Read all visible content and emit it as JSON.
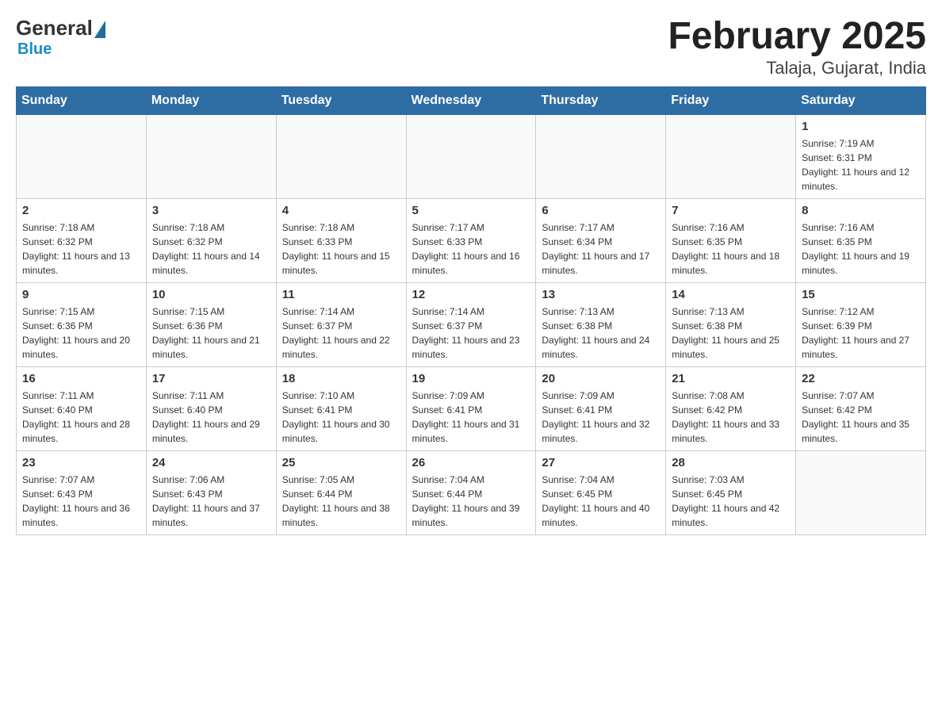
{
  "logo": {
    "general": "General",
    "blue": "Blue"
  },
  "header": {
    "title": "February 2025",
    "subtitle": "Talaja, Gujarat, India"
  },
  "days_of_week": [
    "Sunday",
    "Monday",
    "Tuesday",
    "Wednesday",
    "Thursday",
    "Friday",
    "Saturday"
  ],
  "weeks": [
    [
      {
        "day": "",
        "info": ""
      },
      {
        "day": "",
        "info": ""
      },
      {
        "day": "",
        "info": ""
      },
      {
        "day": "",
        "info": ""
      },
      {
        "day": "",
        "info": ""
      },
      {
        "day": "",
        "info": ""
      },
      {
        "day": "1",
        "info": "Sunrise: 7:19 AM\nSunset: 6:31 PM\nDaylight: 11 hours and 12 minutes."
      }
    ],
    [
      {
        "day": "2",
        "info": "Sunrise: 7:18 AM\nSunset: 6:32 PM\nDaylight: 11 hours and 13 minutes."
      },
      {
        "day": "3",
        "info": "Sunrise: 7:18 AM\nSunset: 6:32 PM\nDaylight: 11 hours and 14 minutes."
      },
      {
        "day": "4",
        "info": "Sunrise: 7:18 AM\nSunset: 6:33 PM\nDaylight: 11 hours and 15 minutes."
      },
      {
        "day": "5",
        "info": "Sunrise: 7:17 AM\nSunset: 6:33 PM\nDaylight: 11 hours and 16 minutes."
      },
      {
        "day": "6",
        "info": "Sunrise: 7:17 AM\nSunset: 6:34 PM\nDaylight: 11 hours and 17 minutes."
      },
      {
        "day": "7",
        "info": "Sunrise: 7:16 AM\nSunset: 6:35 PM\nDaylight: 11 hours and 18 minutes."
      },
      {
        "day": "8",
        "info": "Sunrise: 7:16 AM\nSunset: 6:35 PM\nDaylight: 11 hours and 19 minutes."
      }
    ],
    [
      {
        "day": "9",
        "info": "Sunrise: 7:15 AM\nSunset: 6:36 PM\nDaylight: 11 hours and 20 minutes."
      },
      {
        "day": "10",
        "info": "Sunrise: 7:15 AM\nSunset: 6:36 PM\nDaylight: 11 hours and 21 minutes."
      },
      {
        "day": "11",
        "info": "Sunrise: 7:14 AM\nSunset: 6:37 PM\nDaylight: 11 hours and 22 minutes."
      },
      {
        "day": "12",
        "info": "Sunrise: 7:14 AM\nSunset: 6:37 PM\nDaylight: 11 hours and 23 minutes."
      },
      {
        "day": "13",
        "info": "Sunrise: 7:13 AM\nSunset: 6:38 PM\nDaylight: 11 hours and 24 minutes."
      },
      {
        "day": "14",
        "info": "Sunrise: 7:13 AM\nSunset: 6:38 PM\nDaylight: 11 hours and 25 minutes."
      },
      {
        "day": "15",
        "info": "Sunrise: 7:12 AM\nSunset: 6:39 PM\nDaylight: 11 hours and 27 minutes."
      }
    ],
    [
      {
        "day": "16",
        "info": "Sunrise: 7:11 AM\nSunset: 6:40 PM\nDaylight: 11 hours and 28 minutes."
      },
      {
        "day": "17",
        "info": "Sunrise: 7:11 AM\nSunset: 6:40 PM\nDaylight: 11 hours and 29 minutes."
      },
      {
        "day": "18",
        "info": "Sunrise: 7:10 AM\nSunset: 6:41 PM\nDaylight: 11 hours and 30 minutes."
      },
      {
        "day": "19",
        "info": "Sunrise: 7:09 AM\nSunset: 6:41 PM\nDaylight: 11 hours and 31 minutes."
      },
      {
        "day": "20",
        "info": "Sunrise: 7:09 AM\nSunset: 6:41 PM\nDaylight: 11 hours and 32 minutes."
      },
      {
        "day": "21",
        "info": "Sunrise: 7:08 AM\nSunset: 6:42 PM\nDaylight: 11 hours and 33 minutes."
      },
      {
        "day": "22",
        "info": "Sunrise: 7:07 AM\nSunset: 6:42 PM\nDaylight: 11 hours and 35 minutes."
      }
    ],
    [
      {
        "day": "23",
        "info": "Sunrise: 7:07 AM\nSunset: 6:43 PM\nDaylight: 11 hours and 36 minutes."
      },
      {
        "day": "24",
        "info": "Sunrise: 7:06 AM\nSunset: 6:43 PM\nDaylight: 11 hours and 37 minutes."
      },
      {
        "day": "25",
        "info": "Sunrise: 7:05 AM\nSunset: 6:44 PM\nDaylight: 11 hours and 38 minutes."
      },
      {
        "day": "26",
        "info": "Sunrise: 7:04 AM\nSunset: 6:44 PM\nDaylight: 11 hours and 39 minutes."
      },
      {
        "day": "27",
        "info": "Sunrise: 7:04 AM\nSunset: 6:45 PM\nDaylight: 11 hours and 40 minutes."
      },
      {
        "day": "28",
        "info": "Sunrise: 7:03 AM\nSunset: 6:45 PM\nDaylight: 11 hours and 42 minutes."
      },
      {
        "day": "",
        "info": ""
      }
    ]
  ]
}
